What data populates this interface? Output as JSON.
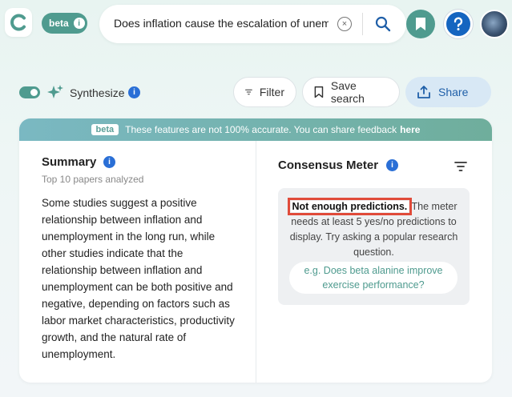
{
  "header": {
    "beta_label": "beta",
    "beta_info_glyph": "i",
    "search_value": "Does inflation cause the escalation of unemp",
    "clear_glyph": "×"
  },
  "toolbar": {
    "synthesize_label": "Synthesize",
    "filter_label": "Filter",
    "save_label": "Save search",
    "share_label": "Share",
    "info_glyph": "i"
  },
  "banner": {
    "tag": "beta",
    "text": "These features are not 100% accurate. You can share feedback",
    "link": "here"
  },
  "summary": {
    "title": "Summary",
    "subtitle": "Top 10 papers analyzed",
    "body": "Some studies suggest a positive relationship between inflation and unemployment in the long run, while other studies indicate that the relationship between inflation and unemployment can be both positive and negative, depending on factors such as labor market characteristics, productivity growth, and the natural rate of unemployment."
  },
  "consensus": {
    "title": "Consensus Meter",
    "highlight": "Not enough predictions.",
    "message": " The meter needs at least 5 yes/no predictions to display. Try asking a popular research question.",
    "example": "e.g. Does beta alanine improve exercise performance?"
  },
  "colors": {
    "accent": "#4f9b8f",
    "info_blue": "#2a6fd6",
    "highlight_border": "#e04b3a",
    "share_bg": "#d8e8f5"
  },
  "icons": [
    "logo-icon",
    "info-icon",
    "clear-icon",
    "search-icon",
    "bookmark-icon",
    "help-icon",
    "avatar",
    "sparkle-icon",
    "filter-icon",
    "bookmark-outline-icon",
    "share-icon",
    "sort-icon"
  ]
}
